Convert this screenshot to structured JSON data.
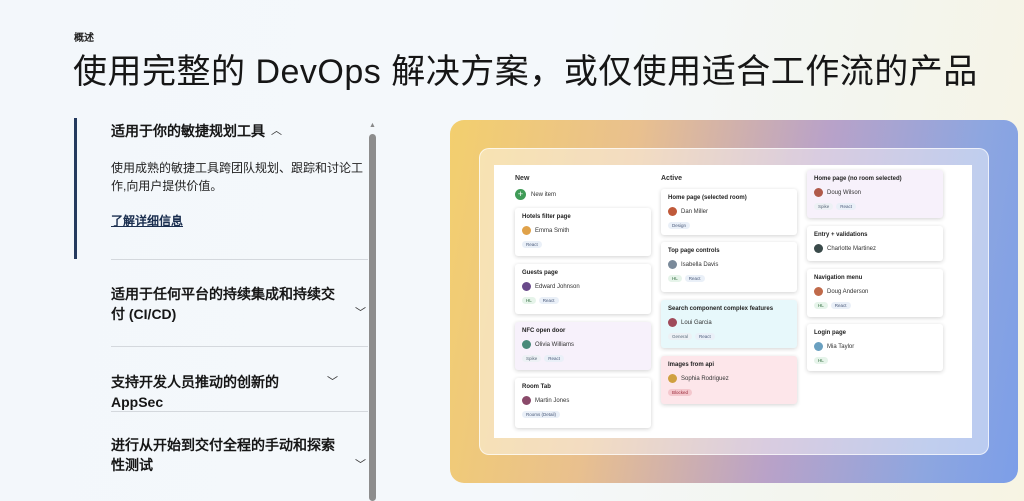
{
  "eyebrow": "概述",
  "headline": "使用完整的 DevOps 解决方案，或仅使用适合工作流的产品",
  "accordion": {
    "active": {
      "title": "适用于你的敏捷规划工具",
      "description": "使用成熟的敏捷工具跨团队规划、跟踪和讨论工作,向用户提供价值。",
      "link": "了解详细信息"
    },
    "items": [
      {
        "title": "适用于任何平台的持续集成和持续交付 (CI/CD)"
      },
      {
        "title": "支持开发人员推动的创新的 AppSec"
      },
      {
        "title": "进行从开始到交付全程的手动和探索性测试"
      }
    ]
  },
  "board": {
    "columns": {
      "new": "New",
      "active": "Active"
    },
    "new_item": "New item",
    "cards": [
      {
        "title": "Hotels filter page",
        "person": "Emma Smith",
        "avatar": "#e0a24a",
        "tags": [
          "React"
        ]
      },
      {
        "title": "Guests page",
        "person": "Edward Johnson",
        "avatar": "#6a4a8a",
        "tags": [
          "HL",
          "React"
        ]
      },
      {
        "title": "NFC open door",
        "person": "Olivia Williams",
        "avatar": "#4a8a7a",
        "tags": [
          "Spike",
          "React"
        ]
      },
      {
        "title": "Room Tab",
        "person": "Martin Jones",
        "avatar": "#8a4a6a",
        "tags": [
          "Rooms (Detail)"
        ]
      },
      {
        "title": "Home page (selected room)",
        "person": "Dan Miller",
        "avatar": "#c05a3a",
        "tags": [
          "Design"
        ]
      },
      {
        "title": "Top page controls",
        "person": "Isabella Davis",
        "avatar": "#7a8a9a",
        "tags": [
          "HL",
          "React"
        ]
      },
      {
        "title": "Search component complex features",
        "person": "Loui Garcia",
        "avatar": "#a04a5a",
        "tags": [
          "General",
          "React"
        ]
      },
      {
        "title": "Images from api",
        "person": "Sophia Rodriguez",
        "avatar": "#d0a040",
        "tags": [
          "Blocked"
        ]
      },
      {
        "title": "Home page (no room selected)",
        "person": "Doug Wilson",
        "avatar": "#b05a4a",
        "tags": [
          "Spike",
          "React"
        ]
      },
      {
        "title": "Entry + validations",
        "person": "Charlotte Martinez",
        "avatar": "#3a4a4a",
        "tags": []
      },
      {
        "title": "Navigation menu",
        "person": "Doug Anderson",
        "avatar": "#c06a4a",
        "tags": [
          "HL",
          "React"
        ]
      },
      {
        "title": "Login page",
        "person": "Mia Taylor",
        "avatar": "#6aa0c0",
        "tags": [
          "HL"
        ]
      }
    ]
  },
  "colors": {
    "accent": "#243a5e",
    "link": "#1a2e4f",
    "new_item": "#3f9b57"
  }
}
